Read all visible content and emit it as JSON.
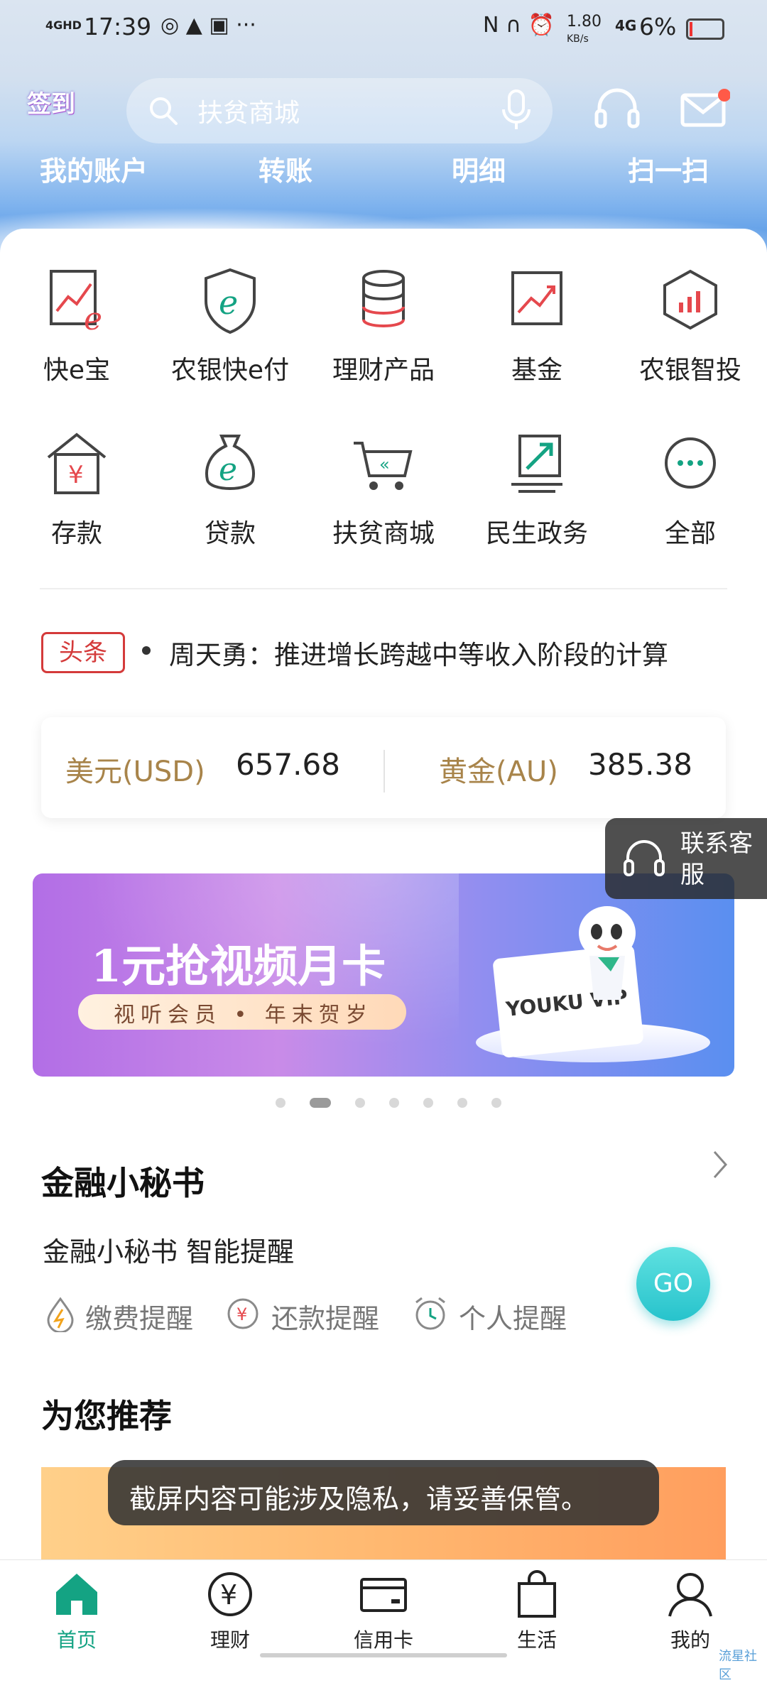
{
  "status_bar": {
    "signal": "4GHD",
    "time": "17:39",
    "speed_value": "1.80",
    "speed_unit": "KB/s",
    "network": "4G",
    "battery": "6%"
  },
  "header": {
    "signin_label": "签到",
    "search_placeholder": "扶贫商城"
  },
  "quick_actions": [
    "我的账户",
    "转账",
    "明细",
    "扫一扫"
  ],
  "grid": [
    {
      "label": "快e宝",
      "icon": "trend-e-icon"
    },
    {
      "label": "农银快e付",
      "icon": "shield-e-icon"
    },
    {
      "label": "理财产品",
      "icon": "coin-stack-icon"
    },
    {
      "label": "基金",
      "icon": "chart-up-icon"
    },
    {
      "label": "农银智投",
      "icon": "hexagon-chart-icon"
    },
    {
      "label": "存款",
      "icon": "house-yen-icon"
    },
    {
      "label": "贷款",
      "icon": "money-bag-e-icon"
    },
    {
      "label": "扶贫商城",
      "icon": "cart-icon"
    },
    {
      "label": "民生政务",
      "icon": "document-arrow-icon"
    },
    {
      "label": "全部",
      "icon": "more-dots-icon"
    }
  ],
  "headline": {
    "tag": "头条",
    "text": "周天勇：推进增长跨越中等收入阶段的计算"
  },
  "rates": {
    "usd_label": "美元(USD)",
    "usd_value": "657.68",
    "gold_label": "黄金(AU)",
    "gold_value": "385.38"
  },
  "contact": {
    "label": "联系客服"
  },
  "banner": {
    "title": "1元抢视频月卡",
    "subtitle": "视听会员 • 年末贺岁",
    "brand": "YOUKU VIP",
    "page_count": 7,
    "active_page": 2
  },
  "secretary": {
    "title": "金融小秘书",
    "subtitle": "金融小秘书 智能提醒",
    "reminders": [
      "缴费提醒",
      "还款提醒",
      "个人提醒"
    ],
    "go_label": "GO"
  },
  "recommend": {
    "title": "为您推荐"
  },
  "toast": "截屏内容可能涉及隐私，请妥善保管。",
  "bottom_nav": [
    {
      "label": "首页",
      "icon": "home-icon",
      "active": true
    },
    {
      "label": "理财",
      "icon": "yen-circle-icon",
      "active": false
    },
    {
      "label": "信用卡",
      "icon": "credit-card-icon",
      "active": false
    },
    {
      "label": "生活",
      "icon": "shopping-bag-icon",
      "active": false
    },
    {
      "label": "我的",
      "icon": "person-icon",
      "active": false
    }
  ],
  "watermark": "流星社区",
  "colors": {
    "accent_green": "#14a383",
    "icon_red": "#e5484d",
    "gold_label": "#a8844a",
    "tag_red": "#d43a3a"
  }
}
